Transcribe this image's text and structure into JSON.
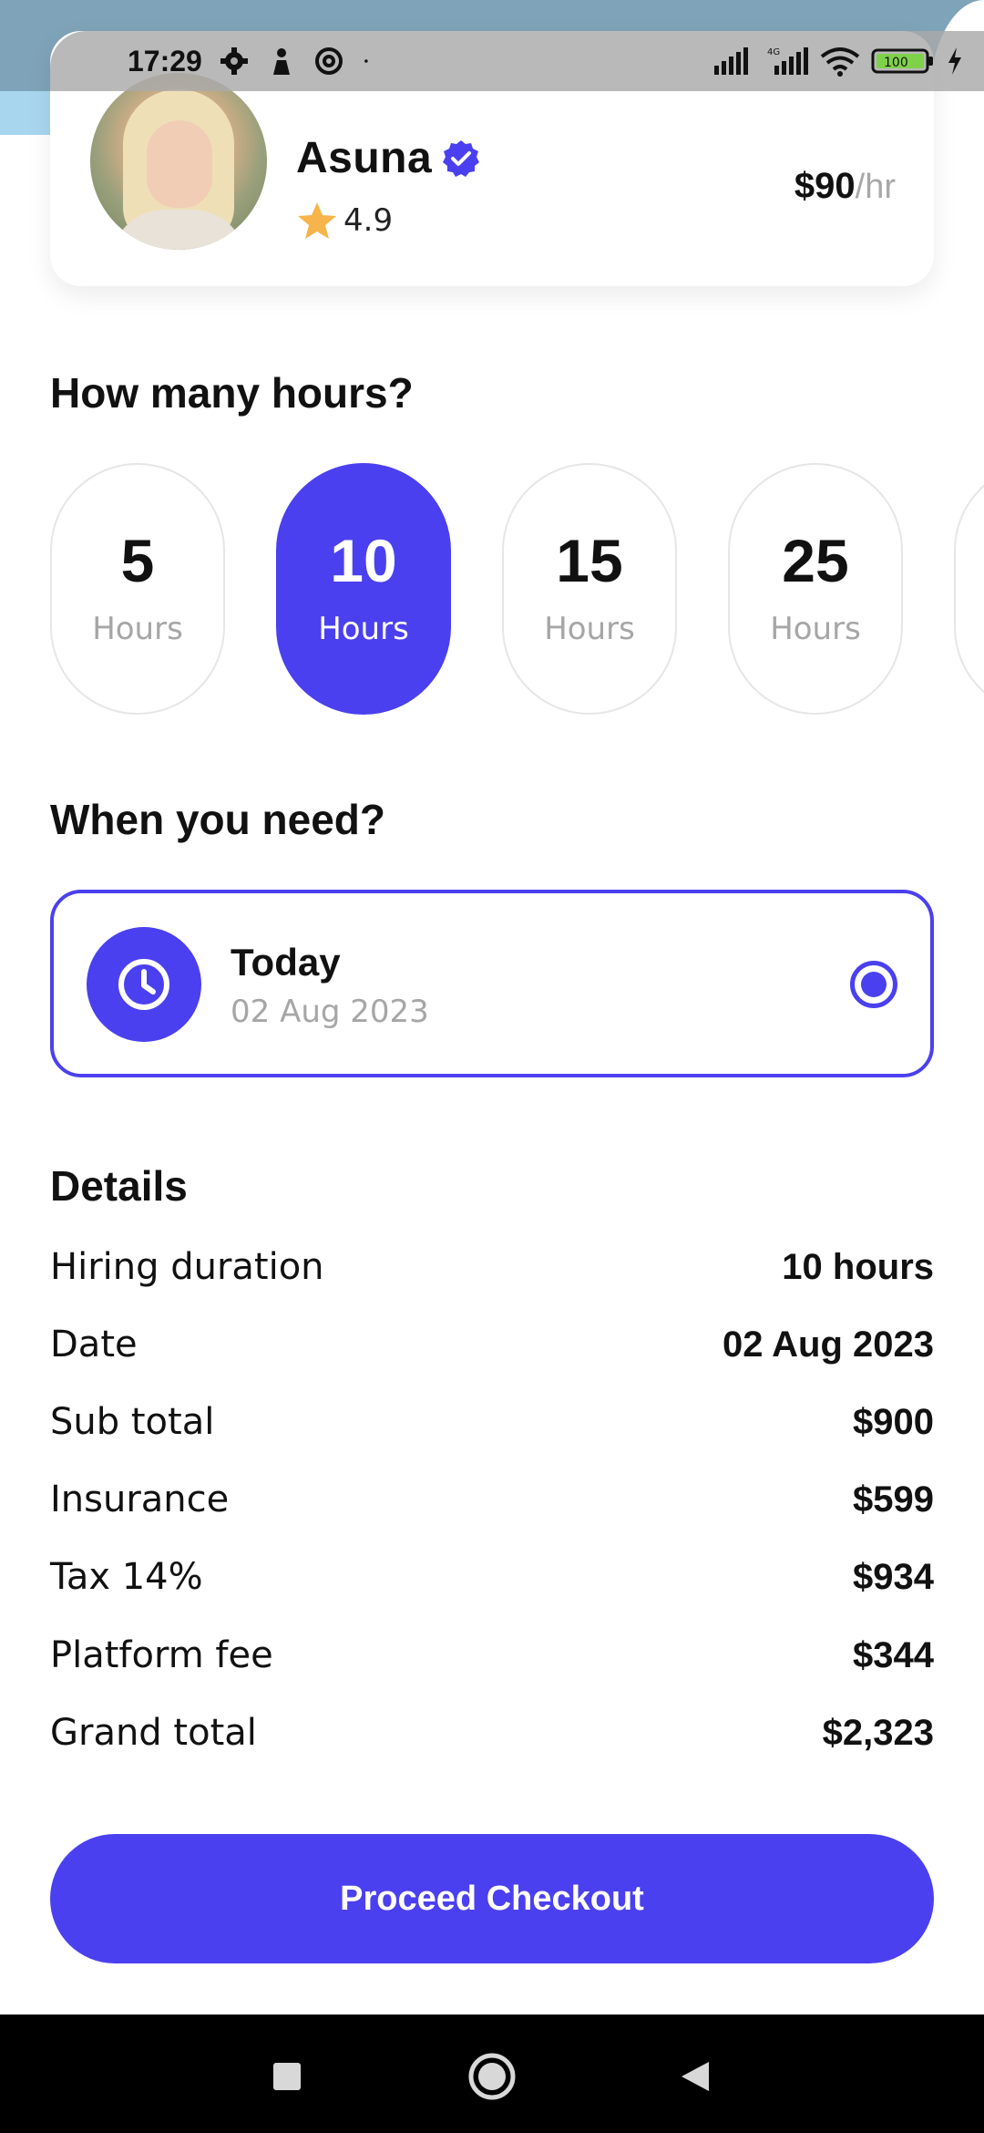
{
  "status_bar": {
    "time": "17:29",
    "battery": "100",
    "network": "4G",
    "icons": [
      "gear-icon",
      "person-icon",
      "at-sign-icon",
      "signal-icon",
      "wifi-icon",
      "battery-icon",
      "charging-icon"
    ]
  },
  "profile": {
    "name": "Asuna",
    "rating": "4.9",
    "price": "$90",
    "price_unit": "/hr"
  },
  "hours": {
    "title": "How many hours?",
    "options": [
      {
        "value": "5",
        "label": "Hours"
      },
      {
        "value": "10",
        "label": "Hours"
      },
      {
        "value": "15",
        "label": "Hours"
      },
      {
        "value": "25",
        "label": "Hours"
      }
    ],
    "selected": "10"
  },
  "when": {
    "title": "When you need?",
    "option_title": "Today",
    "option_date": "02 Aug 2023"
  },
  "details": {
    "title": "Details",
    "rows": [
      {
        "label": "Hiring duration",
        "value": "10 hours"
      },
      {
        "label": "Date",
        "value": "02 Aug 2023"
      },
      {
        "label": "Sub total",
        "value": "$900"
      },
      {
        "label": "Insurance",
        "value": "$599"
      },
      {
        "label": "Tax 14%",
        "value": "$934"
      },
      {
        "label": "Platform fee",
        "value": "$344"
      },
      {
        "label": "Grand total",
        "value": "$2,323"
      }
    ]
  },
  "checkout": {
    "label": "Proceed Checkout"
  },
  "colors": {
    "accent": "#4b40f0",
    "star": "#f7b44a",
    "muted": "#a6a6a6"
  }
}
